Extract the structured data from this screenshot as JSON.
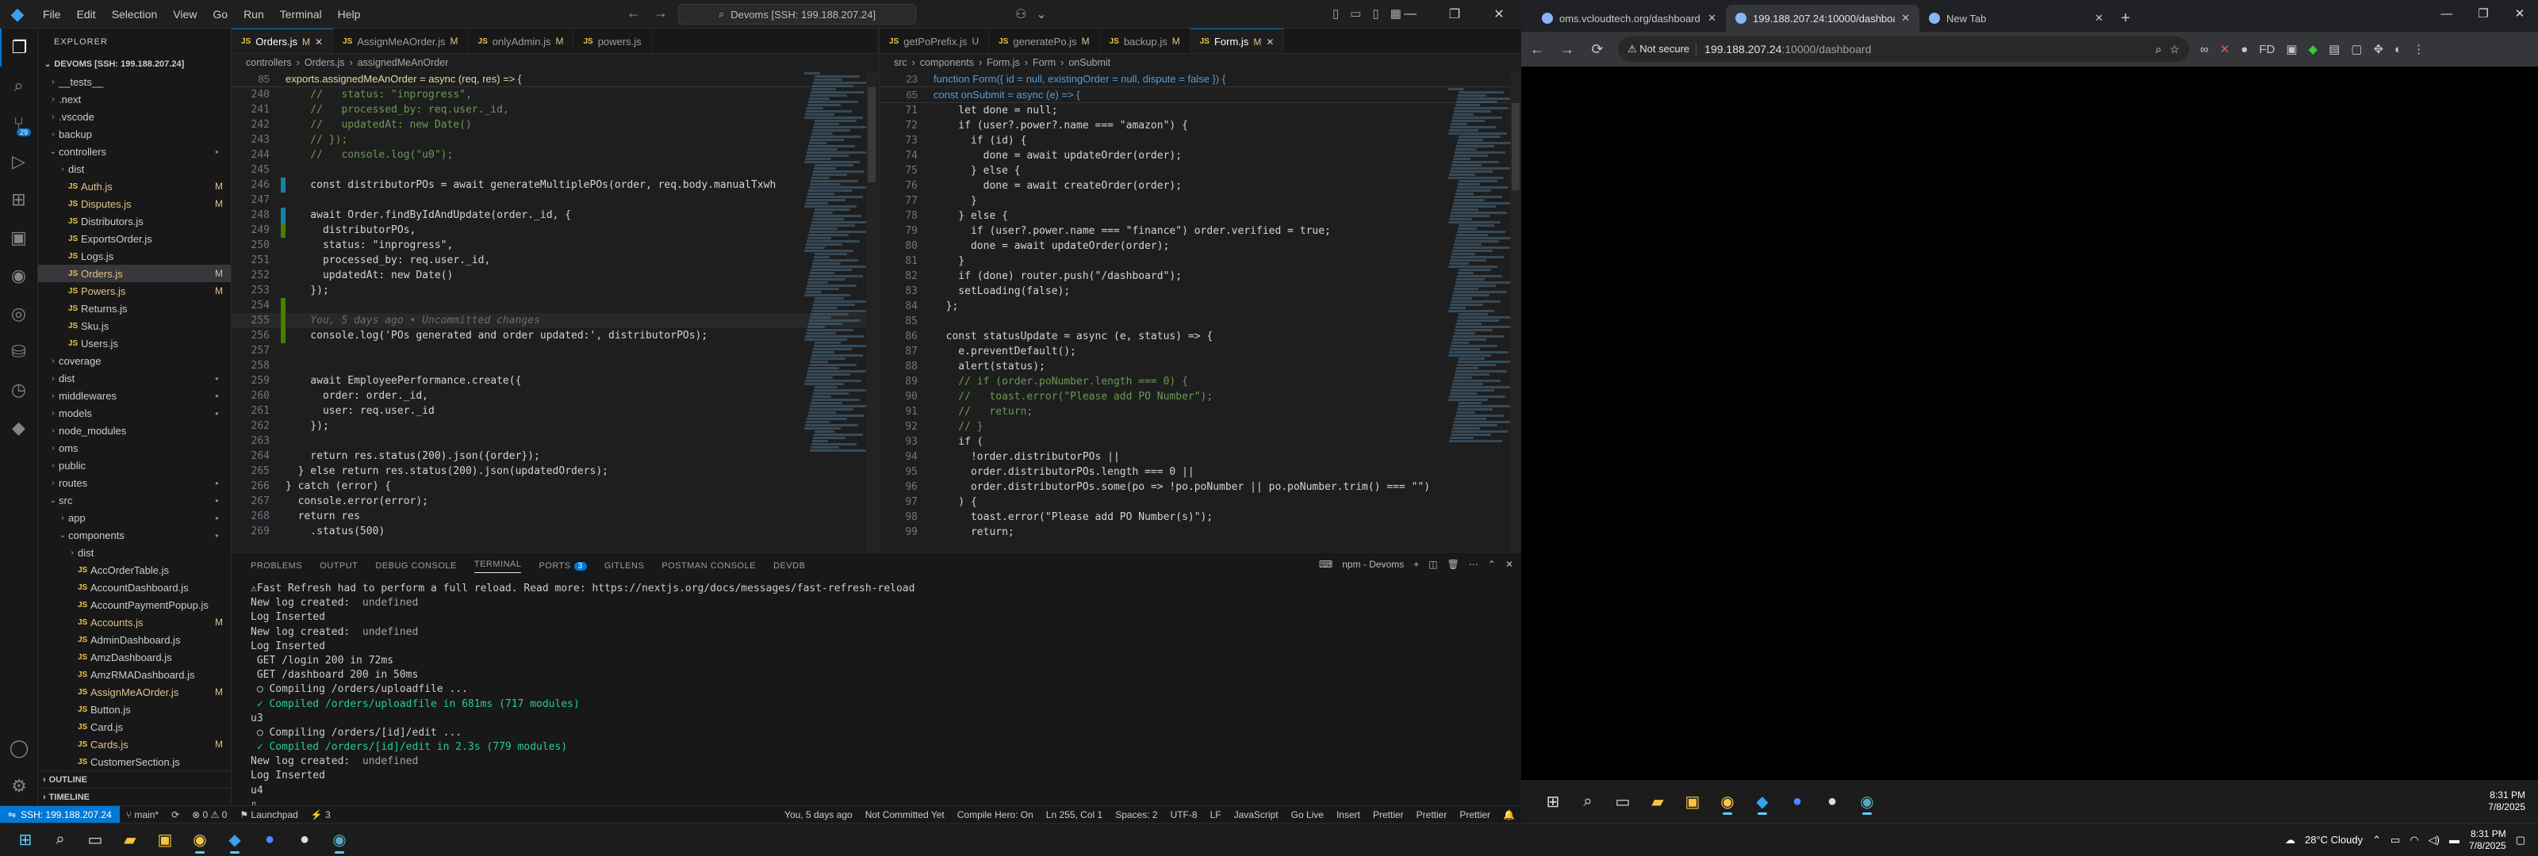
{
  "vscode": {
    "menu": [
      "File",
      "Edit",
      "Selection",
      "View",
      "Go",
      "Run",
      "Terminal",
      "Help"
    ],
    "command_center": "Devoms [SSH: 199.188.207.24]",
    "sidebar": {
      "header": "EXPLORER",
      "root": "DEVOMS [SSH: 199.188.207.24]",
      "items": [
        {
          "label": "__tests__",
          "type": "folder",
          "depth": 1,
          "open": false,
          "status": ""
        },
        {
          "label": ".next",
          "type": "folder",
          "depth": 1,
          "open": false,
          "status": ""
        },
        {
          "label": ".vscode",
          "type": "folder",
          "depth": 1,
          "open": false,
          "status": ""
        },
        {
          "label": "backup",
          "type": "folder",
          "depth": 1,
          "open": false,
          "status": ""
        },
        {
          "label": "controllers",
          "type": "folder",
          "depth": 1,
          "open": true,
          "status": "dot"
        },
        {
          "label": "dist",
          "type": "folder",
          "depth": 2,
          "open": false,
          "status": ""
        },
        {
          "label": "Auth.js",
          "type": "js",
          "depth": 2,
          "status": "M"
        },
        {
          "label": "Disputes.js",
          "type": "js",
          "depth": 2,
          "status": "M"
        },
        {
          "label": "Distributors.js",
          "type": "js",
          "depth": 2,
          "status": ""
        },
        {
          "label": "ExportsOrder.js",
          "type": "js",
          "depth": 2,
          "status": ""
        },
        {
          "label": "Logs.js",
          "type": "js",
          "depth": 2,
          "status": ""
        },
        {
          "label": "Orders.js",
          "type": "js",
          "depth": 2,
          "status": "M",
          "selected": true
        },
        {
          "label": "Powers.js",
          "type": "js",
          "depth": 2,
          "status": "M"
        },
        {
          "label": "Returns.js",
          "type": "js",
          "depth": 2,
          "status": ""
        },
        {
          "label": "Sku.js",
          "type": "js",
          "depth": 2,
          "status": ""
        },
        {
          "label": "Users.js",
          "type": "js",
          "depth": 2,
          "status": ""
        },
        {
          "label": "coverage",
          "type": "folder",
          "depth": 1,
          "open": false,
          "status": ""
        },
        {
          "label": "dist",
          "type": "folder",
          "depth": 1,
          "open": false,
          "status": "dot"
        },
        {
          "label": "middlewares",
          "type": "folder",
          "depth": 1,
          "open": false,
          "status": "dot"
        },
        {
          "label": "models",
          "type": "folder",
          "depth": 1,
          "open": false,
          "status": "dot"
        },
        {
          "label": "node_modules",
          "type": "folder",
          "depth": 1,
          "open": false,
          "status": ""
        },
        {
          "label": "oms",
          "type": "folder",
          "depth": 1,
          "open": false,
          "status": ""
        },
        {
          "label": "public",
          "type": "folder",
          "depth": 1,
          "open": false,
          "status": ""
        },
        {
          "label": "routes",
          "type": "folder",
          "depth": 1,
          "open": false,
          "status": "dot"
        },
        {
          "label": "src",
          "type": "folder",
          "depth": 1,
          "open": true,
          "status": "dot"
        },
        {
          "label": "app",
          "type": "folder",
          "depth": 2,
          "open": false,
          "status": "dot"
        },
        {
          "label": "components",
          "type": "folder",
          "depth": 2,
          "open": true,
          "status": "dot"
        },
        {
          "label": "dist",
          "type": "folder",
          "depth": 3,
          "open": false,
          "status": ""
        },
        {
          "label": "AccOrderTable.js",
          "type": "js",
          "depth": 3,
          "status": ""
        },
        {
          "label": "AccountDashboard.js",
          "type": "js",
          "depth": 3,
          "status": ""
        },
        {
          "label": "AccountPaymentPopup.js",
          "type": "js",
          "depth": 3,
          "status": ""
        },
        {
          "label": "Accounts.js",
          "type": "js",
          "depth": 3,
          "status": "M"
        },
        {
          "label": "AdminDashboard.js",
          "type": "js",
          "depth": 3,
          "status": ""
        },
        {
          "label": "AmzDashboard.js",
          "type": "js",
          "depth": 3,
          "status": ""
        },
        {
          "label": "AmzRMADashboard.js",
          "type": "js",
          "depth": 3,
          "status": ""
        },
        {
          "label": "AssignMeAOrder.js",
          "type": "js",
          "depth": 3,
          "status": "M"
        },
        {
          "label": "Button.js",
          "type": "js",
          "depth": 3,
          "status": ""
        },
        {
          "label": "Card.js",
          "type": "js",
          "depth": 3,
          "status": ""
        },
        {
          "label": "Cards.js",
          "type": "js",
          "depth": 3,
          "status": "M"
        },
        {
          "label": "CustomerSection.js",
          "type": "js",
          "depth": 3,
          "status": ""
        }
      ],
      "outline": "OUTLINE",
      "timeline": "TIMELINE"
    },
    "group1": {
      "tabs": [
        {
          "label": "Orders.js",
          "status": "M",
          "active": true
        },
        {
          "label": "AssignMeAOrder.js",
          "status": "M"
        },
        {
          "label": "onlyAdmin.js",
          "status": "M"
        },
        {
          "label": "powers.js",
          "status": ""
        }
      ],
      "crumbs": [
        "controllers",
        "Orders.js",
        "assignedMeAnOrder"
      ],
      "sticky": {
        "num": "85",
        "text": "exports.assignedMeAnOrder = async (req, res) => {"
      },
      "lines": [
        {
          "n": "240",
          "t": "    //   status: \"inprogress\",",
          "c": "cm"
        },
        {
          "n": "241",
          "t": "    //   processed_by: req.user._id,",
          "c": "cm"
        },
        {
          "n": "242",
          "t": "    //   updatedAt: new Date()",
          "c": "cm"
        },
        {
          "n": "243",
          "t": "    // });",
          "c": "cm"
        },
        {
          "n": "244",
          "t": "    //   console.log(\"u0\");",
          "c": "cm"
        },
        {
          "n": "245",
          "t": "",
          "c": ""
        },
        {
          "n": "246",
          "t": "    const distributorPOs = await generateMultiplePOs(order, req.body.manualTxwh",
          "c": "",
          "g": "mod"
        },
        {
          "n": "247",
          "t": "",
          "c": ""
        },
        {
          "n": "248",
          "t": "    await Order.findByIdAndUpdate(order._id, {",
          "c": "",
          "g": "mod"
        },
        {
          "n": "249",
          "t": "      distributorPOs,",
          "c": "",
          "g": "add"
        },
        {
          "n": "250",
          "t": "      status: \"inprogress\",",
          "c": ""
        },
        {
          "n": "251",
          "t": "      processed_by: req.user._id,",
          "c": ""
        },
        {
          "n": "252",
          "t": "      updatedAt: new Date()",
          "c": ""
        },
        {
          "n": "253",
          "t": "    });",
          "c": ""
        },
        {
          "n": "254",
          "t": "",
          "c": "",
          "g": "add"
        },
        {
          "n": "255",
          "t": "",
          "c": "",
          "blame": "    You, 5 days ago • Uncommitted changes",
          "cur": true,
          "g": "add"
        },
        {
          "n": "256",
          "t": "    console.log('POs generated and order updated:', distributorPOs);",
          "c": "",
          "g": "add"
        },
        {
          "n": "257",
          "t": "",
          "c": ""
        },
        {
          "n": "258",
          "t": "",
          "c": ""
        },
        {
          "n": "259",
          "t": "    await EmployeePerformance.create({",
          "c": ""
        },
        {
          "n": "260",
          "t": "      order: order._id,",
          "c": ""
        },
        {
          "n": "261",
          "t": "      user: req.user._id",
          "c": ""
        },
        {
          "n": "262",
          "t": "    });",
          "c": ""
        },
        {
          "n": "263",
          "t": "",
          "c": ""
        },
        {
          "n": "264",
          "t": "    return res.status(200).json({order});",
          "c": ""
        },
        {
          "n": "265",
          "t": "  } else return res.status(200).json(updatedOrders);",
          "c": ""
        },
        {
          "n": "266",
          "t": "} catch (error) {",
          "c": ""
        },
        {
          "n": "267",
          "t": "  console.error(error);",
          "c": ""
        },
        {
          "n": "268",
          "t": "  return res",
          "c": ""
        },
        {
          "n": "269",
          "t": "    .status(500)",
          "c": ""
        }
      ]
    },
    "group2": {
      "tabs": [
        {
          "label": "getPoPrefix.js",
          "status": "U"
        },
        {
          "label": "generatePo.js",
          "status": "M"
        },
        {
          "label": "backup.js",
          "status": "M"
        },
        {
          "label": "Form.js",
          "status": "M",
          "active": true
        }
      ],
      "crumbs": [
        "src",
        "components",
        "Form.js",
        "Form",
        "onSubmit"
      ],
      "sticky1": {
        "num": "23",
        "text": "function Form({ id = null, existingOrder = null, dispute = false }) {"
      },
      "sticky2": {
        "num": "65",
        "text": "  const onSubmit = async (e) => {"
      },
      "lines": [
        {
          "n": "71",
          "t": "    let done = null;"
        },
        {
          "n": "72",
          "t": "    if (user?.power?.name === \"amazon\") {"
        },
        {
          "n": "73",
          "t": "      if (id) {"
        },
        {
          "n": "74",
          "t": "        done = await updateOrder(order);"
        },
        {
          "n": "75",
          "t": "      } else {"
        },
        {
          "n": "76",
          "t": "        done = await createOrder(order);"
        },
        {
          "n": "77",
          "t": "      }"
        },
        {
          "n": "78",
          "t": "    } else {"
        },
        {
          "n": "79",
          "t": "      if (user?.power.name === \"finance\") order.verified = true;"
        },
        {
          "n": "80",
          "t": "      done = await updateOrder(order);"
        },
        {
          "n": "81",
          "t": "    }"
        },
        {
          "n": "82",
          "t": "    if (done) router.push(\"/dashboard\");"
        },
        {
          "n": "83",
          "t": "    setLoading(false);"
        },
        {
          "n": "84",
          "t": "  };"
        },
        {
          "n": "85",
          "t": ""
        },
        {
          "n": "86",
          "t": "  const statusUpdate = async (e, status) => {"
        },
        {
          "n": "87",
          "t": "    e.preventDefault();"
        },
        {
          "n": "88",
          "t": "    alert(status);"
        },
        {
          "n": "89",
          "t": "    // if (order.poNumber.length === 0) {",
          "c": "cm"
        },
        {
          "n": "90",
          "t": "    //   toast.error(\"Please add PO Number\");",
          "c": "cm"
        },
        {
          "n": "91",
          "t": "    //   return;",
          "c": "cm"
        },
        {
          "n": "92",
          "t": "    // }",
          "c": "cm"
        },
        {
          "n": "93",
          "t": "    if ("
        },
        {
          "n": "94",
          "t": "      !order.distributorPOs ||"
        },
        {
          "n": "95",
          "t": "      order.distributorPOs.length === 0 ||"
        },
        {
          "n": "96",
          "t": "      order.distributorPOs.some(po => !po.poNumber || po.poNumber.trim() === \"\")"
        },
        {
          "n": "97",
          "t": "    ) {"
        },
        {
          "n": "98",
          "t": "      toast.error(\"Please add PO Number(s)\");"
        },
        {
          "n": "99",
          "t": "      return;"
        }
      ]
    },
    "panel": {
      "tabs": [
        "PROBLEMS",
        "OUTPUT",
        "DEBUG CONSOLE",
        "TERMINAL",
        "PORTS",
        "GITLENS",
        "POSTMAN CONSOLE",
        "DEVDB"
      ],
      "ports_count": "3",
      "active": "TERMINAL",
      "term_name": "npm - Devoms",
      "terminal": [
        {
          "t": "⚠Fast Refresh had to perform a full reload. Read more: https://nextjs.org/docs/messages/fast-refresh-reload",
          "k": "w"
        },
        {
          "t": "New log created:  undefined",
          "k": "u"
        },
        {
          "t": "Log Inserted",
          "k": ""
        },
        {
          "t": "New log created:  undefined",
          "k": "u"
        },
        {
          "t": "Log Inserted",
          "k": ""
        },
        {
          "t": " GET /login 200 in 72ms",
          "k": ""
        },
        {
          "t": " GET /dashboard 200 in 50ms",
          "k": ""
        },
        {
          "t": " ○ Compiling /orders/uploadfile ...",
          "k": ""
        },
        {
          "t": " ✓ Compiled /orders/uploadfile in 681ms (717 modules)",
          "k": "g"
        },
        {
          "t": "u3",
          "k": ""
        },
        {
          "t": " ○ Compiling /orders/[id]/edit ...",
          "k": ""
        },
        {
          "t": " ✓ Compiled /orders/[id]/edit in 2.3s (779 modules)",
          "k": "g"
        },
        {
          "t": "New log created:  undefined",
          "k": "u"
        },
        {
          "t": "Log Inserted",
          "k": ""
        },
        {
          "t": "u4",
          "k": ""
        },
        {
          "t": "▯",
          "k": ""
        }
      ]
    },
    "status": {
      "remote": "SSH: 199.188.207.24",
      "branch": "main*",
      "errors": "0",
      "warnings": "0",
      "launchpad": "Launchpad",
      "count3": "3",
      "blame": "You, 5 days ago",
      "not_committed": "Not Committed Yet",
      "compile_hero": "Compile Hero: On",
      "position": "Ln 255, Col 1",
      "spaces": "Spaces: 2",
      "encoding": "UTF-8",
      "eol": "LF",
      "language": "JavaScript",
      "golive": "Go Live",
      "insert": "Insert",
      "prettier1": "Prettier",
      "prettier2": "Prettier",
      "prettier3": "Prettier"
    }
  },
  "chrome": {
    "tabs": [
      {
        "label": "oms.vcloudtech.org/dashboard",
        "active": false
      },
      {
        "label": "199.188.207.24:10000/dashboard",
        "active": true
      },
      {
        "label": "New Tab",
        "active": false
      }
    ],
    "not_secure": "Not secure",
    "url_host": "199.188.207.24",
    "url_path": ":10000/dashboard"
  },
  "taskbar": {
    "right_time": "8:31 PM",
    "right_date": "7/8/2025",
    "weather": "28°C  Cloudy",
    "time": "8:31 PM",
    "date": "7/8/2025"
  }
}
